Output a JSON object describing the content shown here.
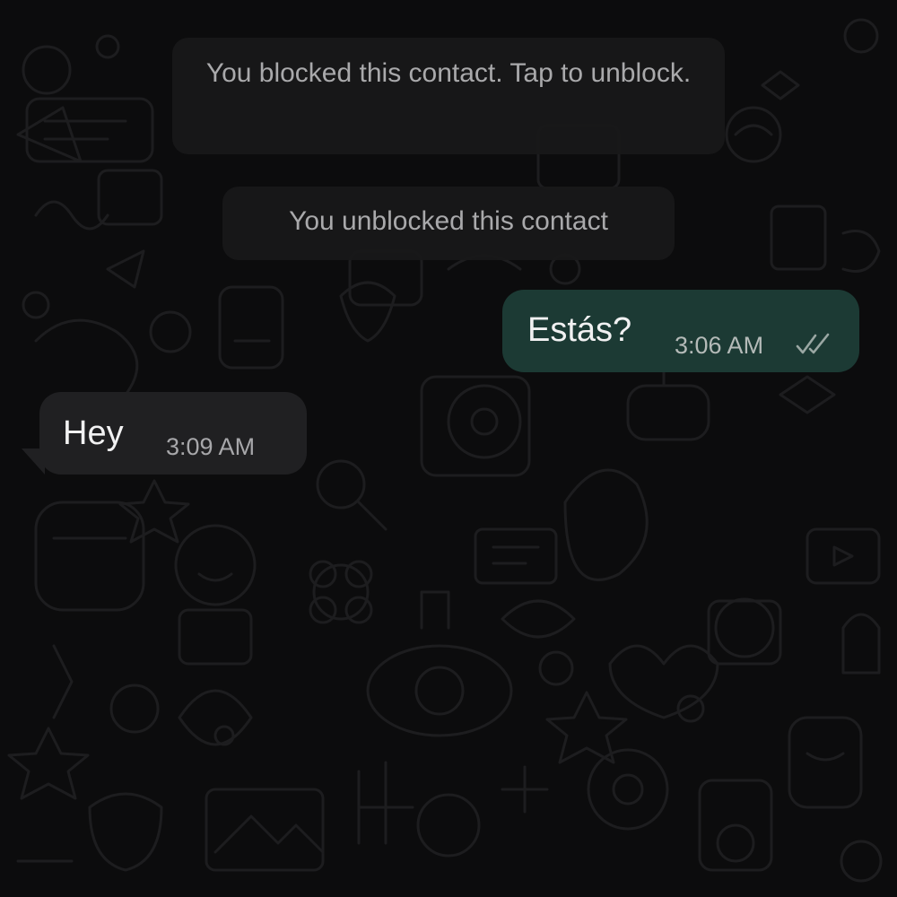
{
  "chat": {
    "system_messages": [
      {
        "text": "You blocked this contact. Tap to unblock."
      },
      {
        "text": "You unblocked this contact"
      }
    ],
    "messages": [
      {
        "direction": "outgoing",
        "text": "Estás?",
        "time": "3:06 AM",
        "status": "read",
        "status_icon": "double-check-icon"
      },
      {
        "direction": "incoming",
        "text": "Hey",
        "time": "3:09 AM"
      }
    ]
  },
  "colors": {
    "background": "#0c0c0d",
    "outgoing_bubble": "#1c3a34",
    "incoming_bubble": "#202022",
    "system_bubble": "#181819",
    "doodle": "#1d1d1f"
  }
}
